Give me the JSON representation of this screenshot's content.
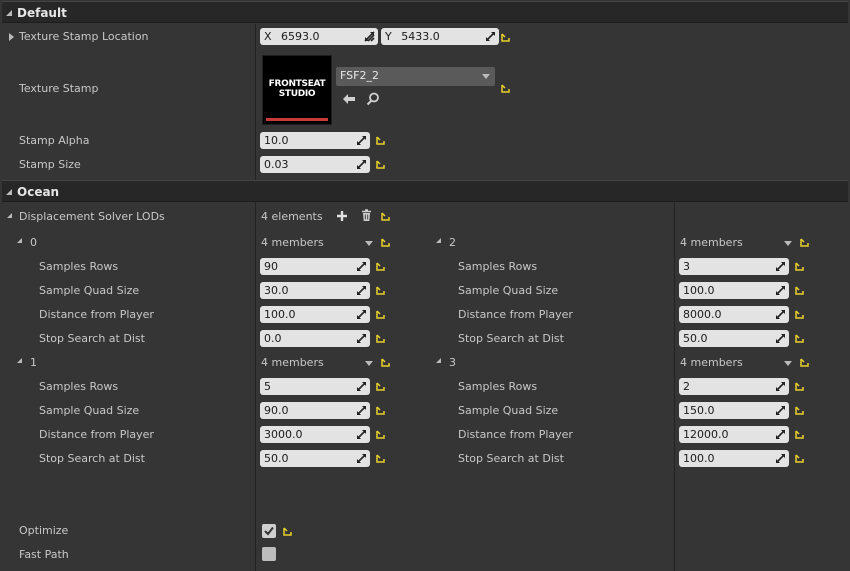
{
  "sections": {
    "default": {
      "title": "Default",
      "texture_stamp_location": {
        "label": "Texture Stamp Location",
        "x_label": "X",
        "x_value": "6593.0",
        "y_label": "Y",
        "y_value": "5433.0"
      },
      "texture_stamp": {
        "label": "Texture Stamp",
        "asset_name": "FSF2_2",
        "thumbnail_text_1": "FRONTSEAT",
        "thumbnail_text_2": "STUDIO"
      },
      "stamp_alpha": {
        "label": "Stamp Alpha",
        "value": "10.0"
      },
      "stamp_size": {
        "label": "Stamp Size",
        "value": "0.03"
      }
    },
    "ocean": {
      "title": "Ocean",
      "displacement_solver_lods": {
        "label": "Displacement Solver LODs",
        "count": "4 elements"
      },
      "lods": [
        {
          "index": "0",
          "members": "4 members",
          "samples_rows": "90",
          "sample_quad_size": "30.0",
          "distance_from_player": "100.0",
          "stop_search_at_dist": "0.0"
        },
        {
          "index": "1",
          "members": "4 members",
          "samples_rows": "5",
          "sample_quad_size": "90.0",
          "distance_from_player": "3000.0",
          "stop_search_at_dist": "50.0"
        },
        {
          "index": "2",
          "members": "4 members",
          "samples_rows": "3",
          "sample_quad_size": "100.0",
          "distance_from_player": "8000.0",
          "stop_search_at_dist": "50.0"
        },
        {
          "index": "3",
          "members": "4 members",
          "samples_rows": "2",
          "sample_quad_size": "150.0",
          "distance_from_player": "12000.0",
          "stop_search_at_dist": "100.0"
        }
      ],
      "member_labels": {
        "samples_rows": "Samples Rows",
        "sample_quad_size": "Sample Quad Size",
        "distance_from_player": "Distance from Player",
        "stop_search_at_dist": "Stop Search at Dist"
      },
      "optimize": {
        "label": "Optimize",
        "checked": true
      },
      "fast_path": {
        "label": "Fast Path",
        "checked": false
      }
    }
  },
  "icons": {
    "expand": "triangle-down-icon",
    "collapsed": "triangle-right-icon",
    "reset": "reset-to-default-icon",
    "drag": "drag-handle-icon",
    "add": "plus-icon",
    "delete": "trash-icon",
    "browse": "arrow-left-icon",
    "search": "magnifier-icon"
  },
  "colors": {
    "panel_bg": "#353535",
    "header_bg": "#272727",
    "field_bg": "#e3e3e3",
    "reset_yellow": "#e8d22a",
    "thumb_bar": "#c83a3a"
  }
}
